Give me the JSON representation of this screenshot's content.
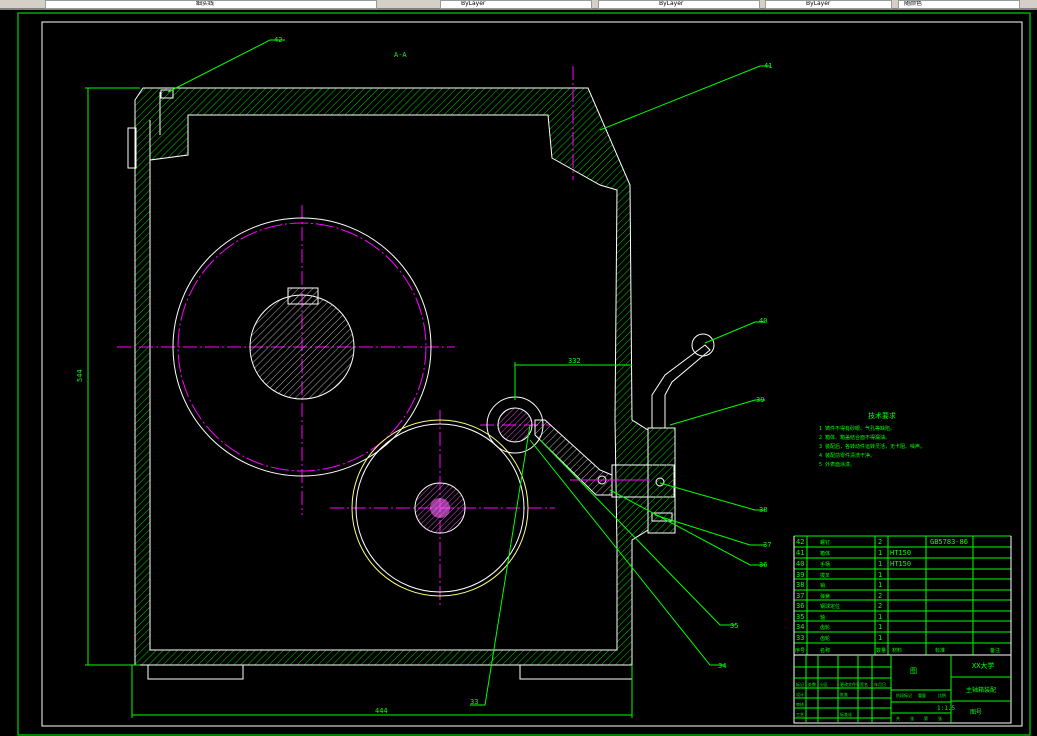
{
  "toolbar": {
    "layer_name": "细实线",
    "dropdowns": [
      "ByLayer",
      "ByLayer",
      "ByLayer",
      "随颜色"
    ]
  },
  "drawing": {
    "section_label": "A-A",
    "dimensions": {
      "height": "544",
      "width": "444",
      "center_distance": "332"
    },
    "leaders": [
      "42",
      "41",
      "40",
      "39",
      "38",
      "37",
      "36",
      "35",
      "34",
      "33"
    ],
    "tech_requirements": {
      "title": "技术要求",
      "items": [
        "1  铸件不得有砂眼、气孔等缺陷。",
        "2  箱体、箱盖结合面不得漏油。",
        "3  装配后，各转动件运转灵活，无卡阻、噪声。",
        "4  装配前零件清洗干净。",
        "5  外表面涂漆。"
      ]
    }
  },
  "parts_list": {
    "rows": [
      {
        "no": "42",
        "name": "螺钉",
        "qty": "2",
        "material": "",
        "standard": "GB5783-86"
      },
      {
        "no": "41",
        "name": "箱体",
        "qty": "1",
        "material": "HT150",
        "standard": ""
      },
      {
        "no": "40",
        "name": "手柄",
        "qty": "1",
        "material": "HT150",
        "standard": ""
      },
      {
        "no": "39",
        "name": "拨叉",
        "qty": "1",
        "material": "",
        "standard": ""
      },
      {
        "no": "38",
        "name": "销",
        "qty": "1",
        "material": "",
        "standard": ""
      },
      {
        "no": "37",
        "name": "弹簧",
        "qty": "2",
        "material": "",
        "standard": ""
      },
      {
        "no": "36",
        "name": "钢球定位",
        "qty": "2",
        "material": "",
        "standard": ""
      },
      {
        "no": "35",
        "name": "轴",
        "qty": "1",
        "material": "",
        "standard": ""
      },
      {
        "no": "34",
        "name": "齿轮",
        "qty": "1",
        "material": "",
        "standard": ""
      },
      {
        "no": "33",
        "name": "齿轮",
        "qty": "1",
        "material": "",
        "standard": ""
      }
    ],
    "header": {
      "no": "序号",
      "name": "名称",
      "qty": "数量",
      "material": "材料",
      "standard": "标准",
      "remark": "备注"
    }
  },
  "title_block": {
    "material_mark": "图",
    "school": "XX大学",
    "drawing_name": "主轴箱装配",
    "drawing_no": "图号",
    "scale": "1:1.5",
    "labels": [
      "标记",
      "处数",
      "分区",
      "更改文件号",
      "签名",
      "年月日",
      "设计",
      "审核",
      "工艺",
      "批准",
      "标准化",
      "阶段标记",
      "重量",
      "比例",
      "共",
      "张",
      "第",
      "张"
    ]
  }
}
